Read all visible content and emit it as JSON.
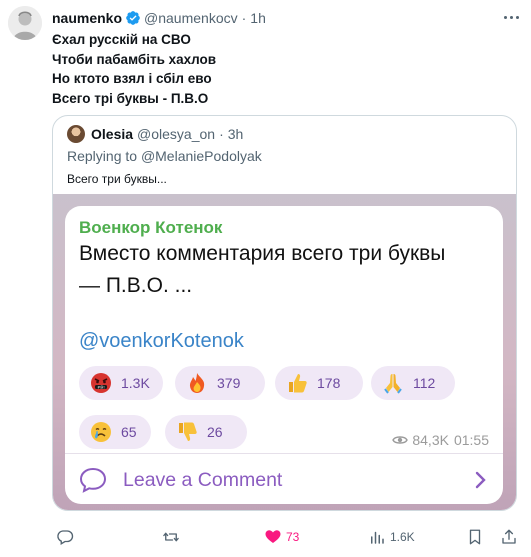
{
  "tweet": {
    "author_name": "naumenko",
    "handle": "@naumenkocv",
    "separator": "·",
    "time": "1h",
    "lines": [
      "Єхал русскій на СВО",
      "Чтоби пабамбіть хахлов",
      "Но ктото взял і сбіл ево",
      "Всего трі буквы - П.В.О"
    ]
  },
  "quote": {
    "author_name": "Olesia",
    "handle": "@olesya_on",
    "separator": "·",
    "time": "3h",
    "replying_prefix": "Replying to",
    "replying_to": "@MelaniePodolyak",
    "text": "Всего три буквы..."
  },
  "media": {
    "channel_name": "Военкор Котенок",
    "post_lines": [
      "Вместо комментария всего три буквы",
      "— П.В.О. ..."
    ],
    "link": "@voenkorKotenok",
    "reactions": [
      {
        "icon": "angry-swearing-face-icon",
        "count": "1.3K"
      },
      {
        "icon": "fire-icon",
        "count": "379"
      },
      {
        "icon": "thumbs-up-icon",
        "count": "178"
      },
      {
        "icon": "praying-hands-icon",
        "count": "112"
      },
      {
        "icon": "crying-face-icon",
        "count": "65"
      },
      {
        "icon": "thumbs-down-icon",
        "count": "26"
      }
    ],
    "views": "84,3K",
    "post_time": "01:55",
    "comment_label": "Leave a Comment"
  },
  "actions": {
    "replies": "",
    "reposts": "",
    "likes": "73",
    "views": "1.6K"
  },
  "colors": {
    "like": "#f91880",
    "channel": "#4fae4e",
    "link": "#3a84c8",
    "comment": "#8b5cc0",
    "verified": "#1d9bf0"
  }
}
